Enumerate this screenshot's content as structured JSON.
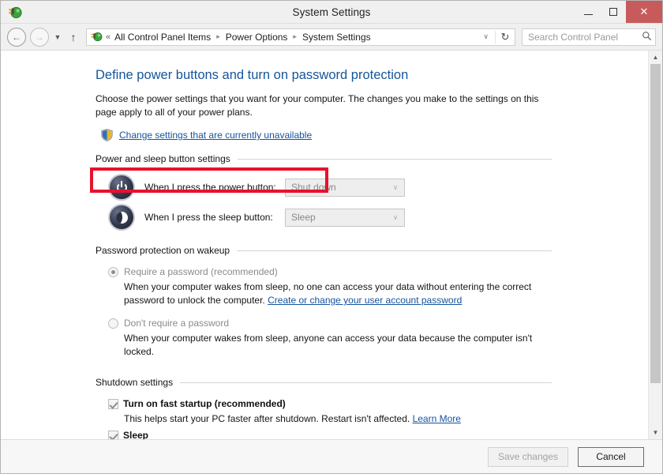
{
  "window": {
    "title": "System Settings",
    "icon": "power-plug-icon",
    "minimize_label": "Minimize",
    "maximize_label": "Maximize",
    "close_label": "✕"
  },
  "navbar": {
    "back_icon": "←",
    "forward_icon": "→",
    "history_caret": "▼",
    "up_icon": "↑",
    "address_icon": "power-plug-icon",
    "chevrons": "«",
    "breadcrumbs": [
      "All Control Panel Items",
      "Power Options",
      "System Settings"
    ],
    "separator": "▸",
    "dropdown_caret": "∨",
    "refresh_icon": "↻",
    "search_placeholder": "Search Control Panel",
    "search_value": "",
    "search_icon": "⚲"
  },
  "page": {
    "title": "Define power buttons and turn on password protection",
    "description": "Choose the power settings that you want for your computer. The changes you make to the settings on this page apply to all of your power plans.",
    "uac_link": "Change settings that are currently unavailable",
    "highlight_color": "#e8112d"
  },
  "power_sleep": {
    "group_label": "Power and sleep button settings",
    "rows": [
      {
        "icon": "power-button-icon",
        "label": "When I press the power button:",
        "value": "Shut down",
        "caret": "∨"
      },
      {
        "icon": "sleep-button-icon",
        "label": "When I press the sleep button:",
        "value": "Sleep",
        "caret": "∨"
      }
    ]
  },
  "password_protection": {
    "group_label": "Password protection on wakeup",
    "options": [
      {
        "title": "Require a password (recommended)",
        "checked": true,
        "body_before": "When your computer wakes from sleep, no one can access your data without entering the correct password to unlock the computer. ",
        "link": "Create or change your user account password",
        "body_after": ""
      },
      {
        "title": "Don't require a password",
        "checked": false,
        "body_before": "When your computer wakes from sleep, anyone can access your data because the computer isn't locked.",
        "link": "",
        "body_after": ""
      }
    ]
  },
  "shutdown_settings": {
    "group_label": "Shutdown settings",
    "items": [
      {
        "label": "Turn on fast startup (recommended)",
        "checked": true,
        "body_before": "This helps start your PC faster after shutdown. Restart isn't affected. ",
        "link": "Learn More"
      },
      {
        "label": "Sleep",
        "checked": true,
        "body_before": "",
        "link": ""
      }
    ]
  },
  "footer": {
    "save_label": "Save changes",
    "save_disabled": true,
    "cancel_label": "Cancel"
  },
  "scrollbar": {
    "up_arrow": "▲",
    "down_arrow": "▼"
  }
}
